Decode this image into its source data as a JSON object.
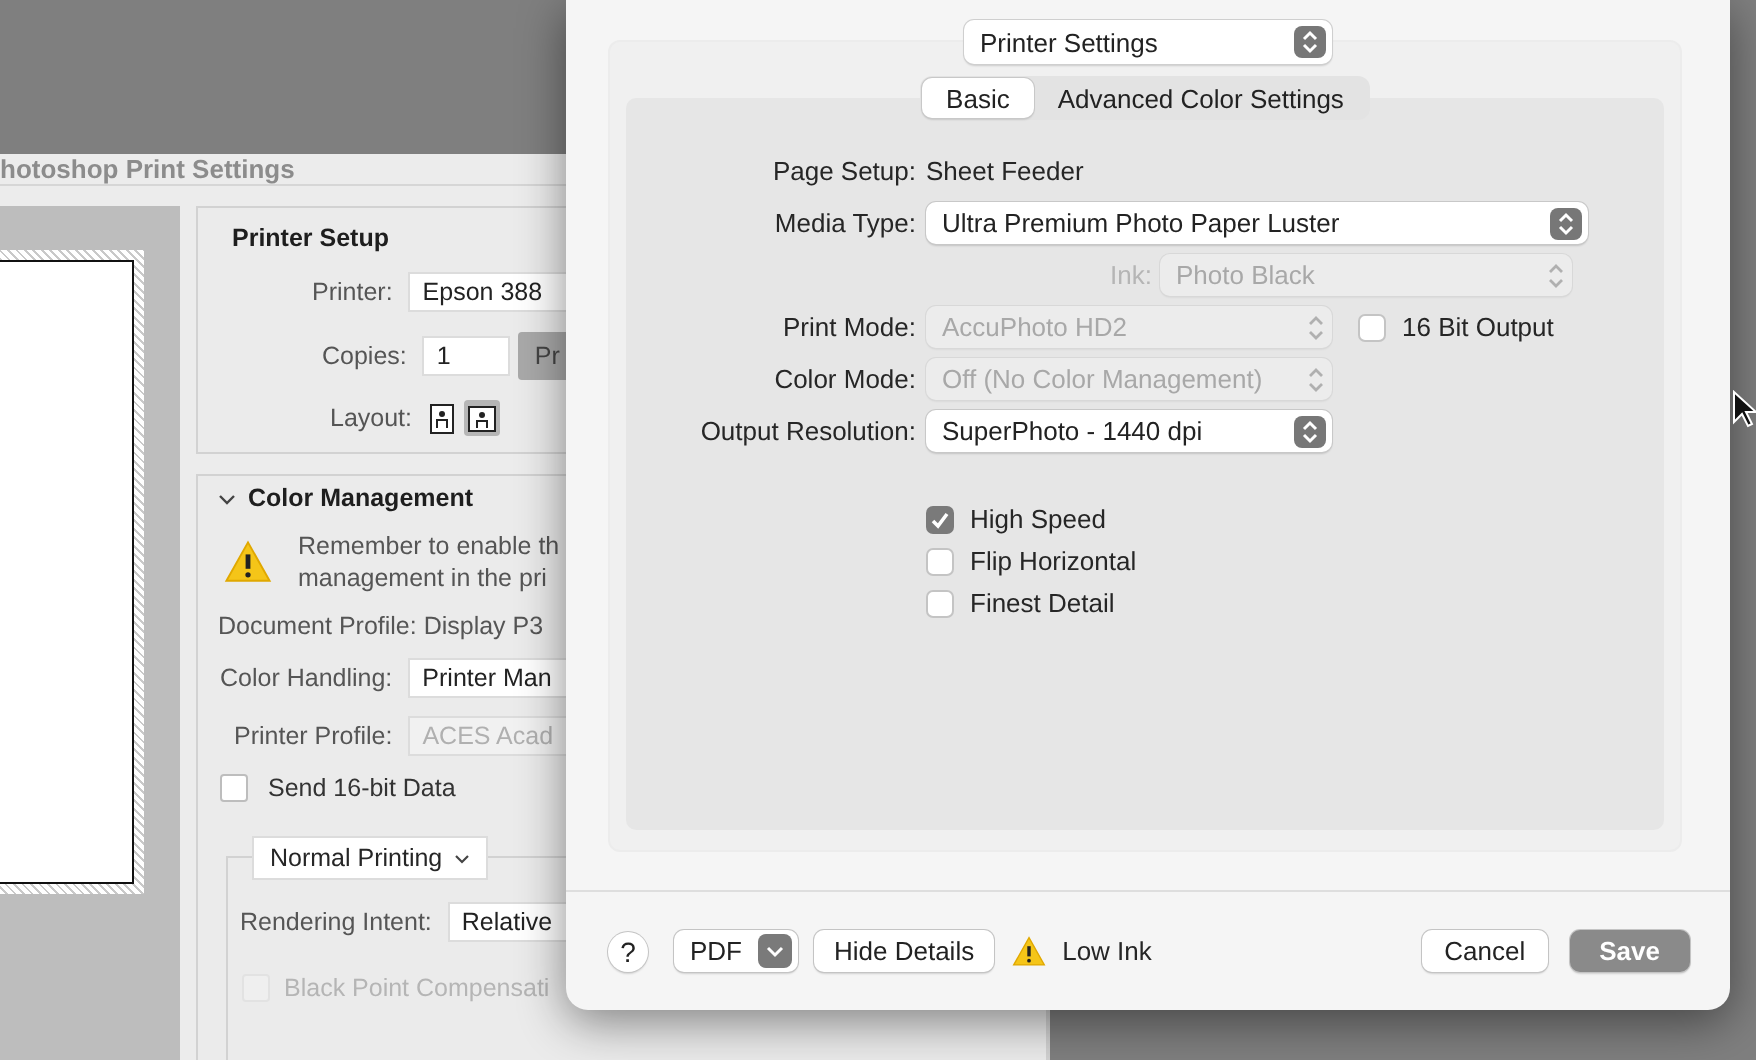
{
  "background_window": {
    "title": "hotoshop Print Settings",
    "printer_setup": {
      "title": "Printer Setup",
      "printer_label": "Printer:",
      "printer": "Epson 388",
      "copies_label": "Copies:",
      "copies": "1",
      "button": "Pr",
      "layout_label": "Layout:",
      "layout_options": [
        {
          "kind": "portrait",
          "selected": false
        },
        {
          "kind": "landscape",
          "selected": true
        }
      ]
    },
    "color_management": {
      "title": "Color Management",
      "expanded": true,
      "notice": [
        "Remember to enable th",
        "management in the pri"
      ],
      "document_profile": "Document Profile: Display P3",
      "color_handling_label": "Color Handling:",
      "color_handling": "Printer Man",
      "printer_profile_label": "Printer Profile:",
      "printer_profile": "ACES Acad",
      "send_16bit": {
        "label": "Send 16-bit Data",
        "checked": false
      },
      "printing_mode": "Normal Printing",
      "rendering_intent_label": "Rendering Intent:",
      "rendering_intent": "Relative",
      "black_point": {
        "label": "Black Point Compensati",
        "checked": false,
        "disabled": true
      }
    }
  },
  "print_dialog": {
    "panel_menu": "Printer Settings",
    "tabs": [
      {
        "label": "Basic",
        "selected": true
      },
      {
        "label": "Advanced Color Settings",
        "selected": false
      }
    ],
    "page_setup": {
      "label": "Page Setup:",
      "value": "Sheet Feeder"
    },
    "media_type": {
      "label": "Media Type:",
      "value": "Ultra Premium Photo Paper Luster",
      "disabled": false
    },
    "ink": {
      "label": "Ink:",
      "value": "Photo Black",
      "disabled": true
    },
    "print_mode": {
      "label": "Print Mode:",
      "value": "AccuPhoto HD2",
      "disabled": true
    },
    "sixteen_bit_output": {
      "label": "16 Bit Output",
      "checked": false
    },
    "color_mode": {
      "label": "Color Mode:",
      "value": "Off (No Color Management)",
      "disabled": true
    },
    "output_resolution": {
      "label": "Output Resolution:",
      "value": "SuperPhoto - 1440 dpi",
      "disabled": false
    },
    "options": [
      {
        "label": "High Speed",
        "checked": true
      },
      {
        "label": "Flip Horizontal",
        "checked": false
      },
      {
        "label": "Finest Detail",
        "checked": false
      }
    ],
    "footer": {
      "help": "?",
      "pdf": "PDF",
      "hide_details": "Hide Details",
      "status": "Low Ink",
      "cancel": "Cancel",
      "save": "Save"
    }
  }
}
